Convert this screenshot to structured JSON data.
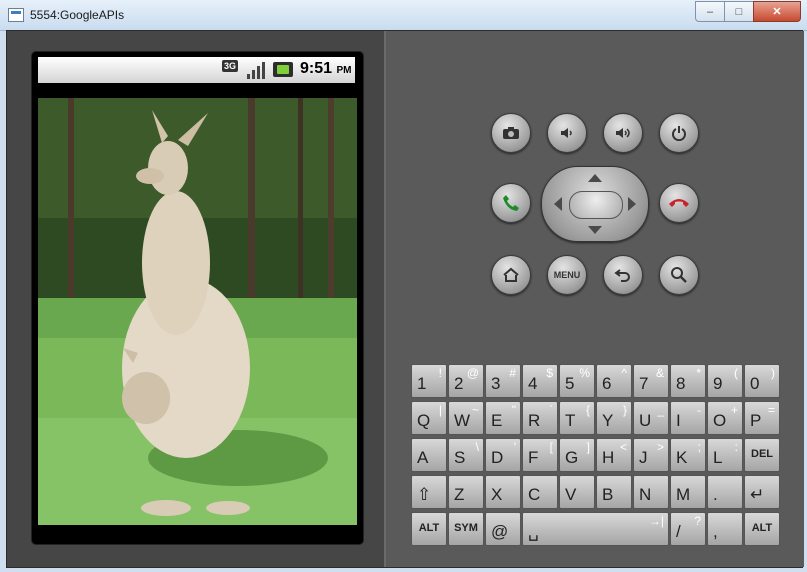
{
  "window": {
    "title": "5554:GoogleAPIs",
    "controls": {
      "minimize": "‒",
      "maximize": "□",
      "close": "✕"
    }
  },
  "statusbar": {
    "network": "3G",
    "time": "9:51",
    "ampm": "PM"
  },
  "controls": {
    "menu_label": "MENU"
  },
  "keyboard": {
    "rows": [
      [
        {
          "main": "1",
          "alt": "!"
        },
        {
          "main": "2",
          "alt": "@"
        },
        {
          "main": "3",
          "alt": "#"
        },
        {
          "main": "4",
          "alt": "$"
        },
        {
          "main": "5",
          "alt": "%"
        },
        {
          "main": "6",
          "alt": "^"
        },
        {
          "main": "7",
          "alt": "&"
        },
        {
          "main": "8",
          "alt": "*"
        },
        {
          "main": "9",
          "alt": "("
        },
        {
          "main": "0",
          "alt": ")"
        }
      ],
      [
        {
          "main": "Q",
          "alt": "|"
        },
        {
          "main": "W",
          "alt": "~"
        },
        {
          "main": "E",
          "alt": "\""
        },
        {
          "main": "R",
          "alt": "`"
        },
        {
          "main": "T",
          "alt": "{"
        },
        {
          "main": "Y",
          "alt": "}"
        },
        {
          "main": "U",
          "alt": "_"
        },
        {
          "main": "I",
          "alt": "-"
        },
        {
          "main": "O",
          "alt": "+"
        },
        {
          "main": "P",
          "alt": "="
        }
      ],
      [
        {
          "main": "A",
          "alt": ""
        },
        {
          "main": "S",
          "alt": "\\"
        },
        {
          "main": "D",
          "alt": "'"
        },
        {
          "main": "F",
          "alt": "["
        },
        {
          "main": "G",
          "alt": "]"
        },
        {
          "main": "H",
          "alt": "<"
        },
        {
          "main": "J",
          "alt": ">"
        },
        {
          "main": "K",
          "alt": ";"
        },
        {
          "main": "L",
          "alt": ":"
        },
        {
          "main": "DEL",
          "alt": ""
        }
      ],
      [
        {
          "main": "⇧",
          "alt": ""
        },
        {
          "main": "Z",
          "alt": ""
        },
        {
          "main": "X",
          "alt": ""
        },
        {
          "main": "C",
          "alt": ""
        },
        {
          "main": "V",
          "alt": ""
        },
        {
          "main": "B",
          "alt": ""
        },
        {
          "main": "N",
          "alt": ""
        },
        {
          "main": "M",
          "alt": ""
        },
        {
          "main": ".",
          "alt": ""
        },
        {
          "main": "↵",
          "alt": ""
        }
      ],
      [
        {
          "main": "ALT",
          "alt": ""
        },
        {
          "main": "SYM",
          "alt": ""
        },
        {
          "main": "@",
          "alt": ""
        },
        {
          "main": "␣",
          "alt": "→|"
        },
        {
          "main": "/",
          "alt": "?"
        },
        {
          "main": ",",
          "alt": ""
        },
        {
          "main": "ALT",
          "alt": ""
        }
      ]
    ]
  }
}
